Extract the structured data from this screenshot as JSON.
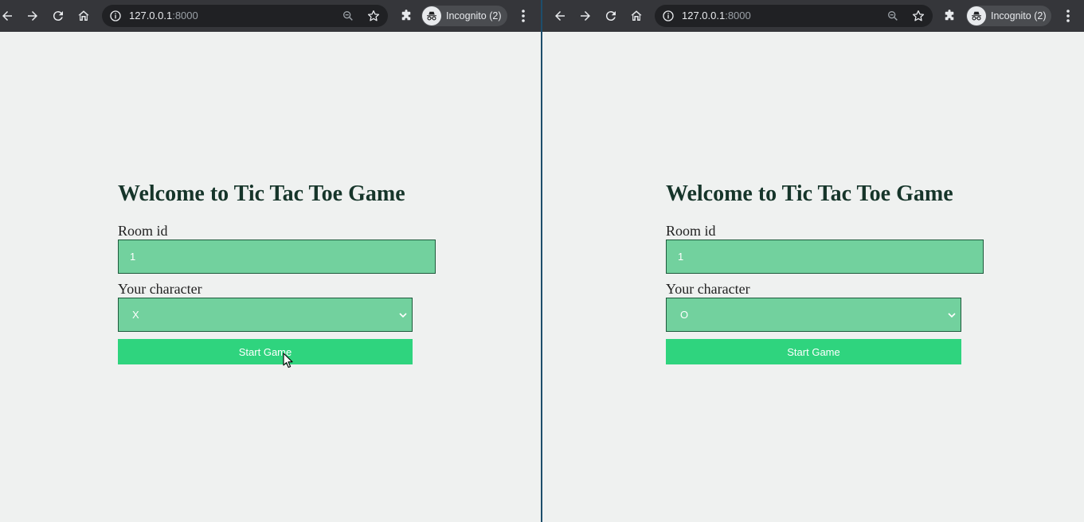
{
  "windows": [
    {
      "id": "left",
      "browser": {
        "url_host": "127.0.0.1",
        "url_port": ":8000",
        "profile_label": "Incognito (2)"
      },
      "page": {
        "title": "Welcome to Tic Tac Toe Game",
        "room_label": "Room id",
        "room_value": "1",
        "character_label": "Your character",
        "character_value": "X",
        "start_label": "Start Game"
      }
    },
    {
      "id": "right",
      "browser": {
        "url_host": "127.0.0.1",
        "url_port": ":8000",
        "profile_label": "Incognito (2)"
      },
      "page": {
        "title": "Welcome to Tic Tac Toe Game",
        "room_label": "Room id",
        "room_value": "1",
        "character_label": "Your character",
        "character_value": "O",
        "start_label": "Start Game"
      }
    }
  ],
  "icons": {
    "back": "arrow-left-icon",
    "forward": "arrow-right-icon",
    "reload": "reload-icon",
    "home": "home-icon",
    "info": "info-icon",
    "zoom": "zoom-icon",
    "bookmark": "star-icon",
    "extensions": "puzzle-icon",
    "profile": "incognito-icon",
    "menu": "kebab-menu-icon"
  },
  "colors": {
    "toolbar": "#35363a",
    "omnibox": "#202124",
    "page_bg": "#eff1f0",
    "field_bg": "#72d19e",
    "field_border": "#1e5a3c",
    "button_bg": "#2fd47e",
    "title_text": "#16352a"
  }
}
